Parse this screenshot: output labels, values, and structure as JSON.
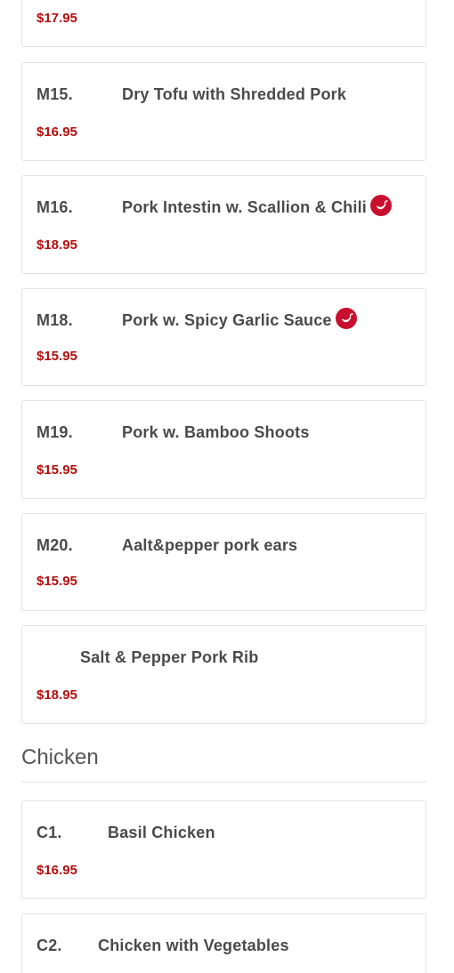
{
  "top_partial_price": "$17.95",
  "items": [
    {
      "code": "M15.",
      "name": "Dry Tofu with Shredded Pork",
      "price": "$16.95",
      "spicy": false
    },
    {
      "code": "M16.",
      "name": "Pork Intestin w. Scallion & Chili",
      "price": "$18.95",
      "spicy": true
    },
    {
      "code": "M18.",
      "name": "Pork w. Spicy Garlic Sauce",
      "price": "$15.95",
      "spicy": true
    },
    {
      "code": "M19.",
      "name": "Pork w. Bamboo Shoots",
      "price": "$15.95",
      "spicy": false
    },
    {
      "code": "M20.",
      "name": "Aalt&pepper pork ears",
      "price": "$15.95",
      "spicy": false
    },
    {
      "code": "",
      "name": "Salt & Pepper Pork Rib",
      "price": "$18.95",
      "spicy": false
    }
  ],
  "section": {
    "title": "Chicken"
  },
  "chicken_items": [
    {
      "code": "C1.",
      "name": "Basil Chicken",
      "price": "$16.95",
      "spicy": false
    },
    {
      "code": "C2.",
      "name": "Chicken with Vegetables",
      "price": "",
      "spicy": false
    }
  ],
  "icons": {
    "spicy": "chili-pepper-icon"
  },
  "colors": {
    "price": "#b20d0d",
    "spicy_badge": "#c8102e"
  }
}
